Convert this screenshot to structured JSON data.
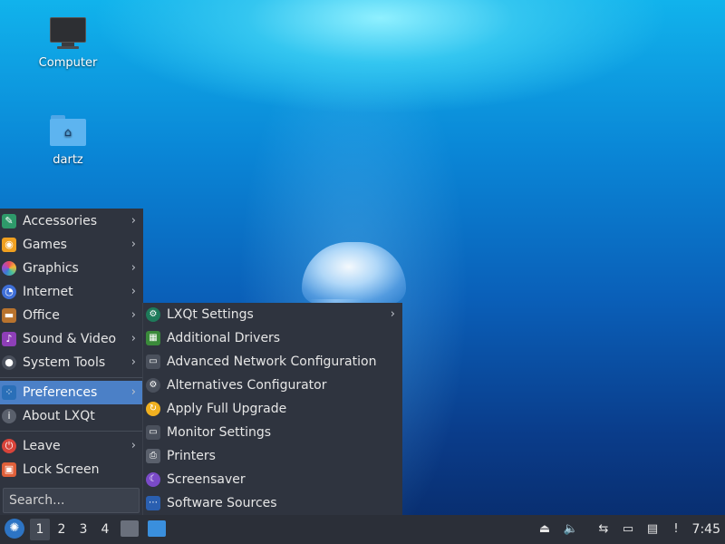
{
  "desktop": {
    "icons": [
      {
        "label": "Computer",
        "icon": "computer-icon"
      },
      {
        "label": "dartz",
        "icon": "home-folder-icon"
      }
    ]
  },
  "menu": {
    "items": [
      {
        "label": "Accessories",
        "icon": "accessories-icon",
        "has_submenu": true
      },
      {
        "label": "Games",
        "icon": "games-icon",
        "has_submenu": true
      },
      {
        "label": "Graphics",
        "icon": "graphics-icon",
        "has_submenu": true
      },
      {
        "label": "Internet",
        "icon": "internet-icon",
        "has_submenu": true
      },
      {
        "label": "Office",
        "icon": "office-icon",
        "has_submenu": true
      },
      {
        "label": "Sound & Video",
        "icon": "sound-video-icon",
        "has_submenu": true
      },
      {
        "label": "System Tools",
        "icon": "system-tools-icon",
        "has_submenu": true
      },
      {
        "label": "Preferences",
        "icon": "preferences-icon",
        "has_submenu": true,
        "active": true
      },
      {
        "label": "About LXQt",
        "icon": "about-icon",
        "has_submenu": false
      },
      {
        "label": "Leave",
        "icon": "leave-icon",
        "has_submenu": true
      },
      {
        "label": "Lock Screen",
        "icon": "lock-icon",
        "has_submenu": false
      }
    ],
    "search_placeholder": "Search..."
  },
  "submenu": {
    "items": [
      {
        "label": "LXQt Settings",
        "icon": "lxqt-settings-icon",
        "has_submenu": true
      },
      {
        "label": "Additional Drivers",
        "icon": "drivers-icon",
        "has_submenu": false
      },
      {
        "label": "Advanced Network Configuration",
        "icon": "network-config-icon",
        "has_submenu": false
      },
      {
        "label": "Alternatives Configurator",
        "icon": "alternatives-icon",
        "has_submenu": false
      },
      {
        "label": "Apply Full Upgrade",
        "icon": "upgrade-icon",
        "has_submenu": false
      },
      {
        "label": "Monitor Settings",
        "icon": "monitor-settings-icon",
        "has_submenu": false
      },
      {
        "label": "Printers",
        "icon": "printer-icon",
        "has_submenu": false
      },
      {
        "label": "Screensaver",
        "icon": "screensaver-icon",
        "has_submenu": false
      },
      {
        "label": "Software Sources",
        "icon": "software-sources-icon",
        "has_submenu": false
      }
    ]
  },
  "taskbar": {
    "workspaces": [
      "1",
      "2",
      "3",
      "4"
    ],
    "active_workspace": "1",
    "clock": "7:45",
    "tray_icons": [
      "eject-icon",
      "volume-icon",
      "network-icon",
      "display-icon",
      "clipboard-icon",
      "update-notifier-icon"
    ]
  },
  "colors": {
    "panel_bg": "#2f343f",
    "highlight": "#4b80c7",
    "taskbar_bg": "#2b2f38"
  }
}
